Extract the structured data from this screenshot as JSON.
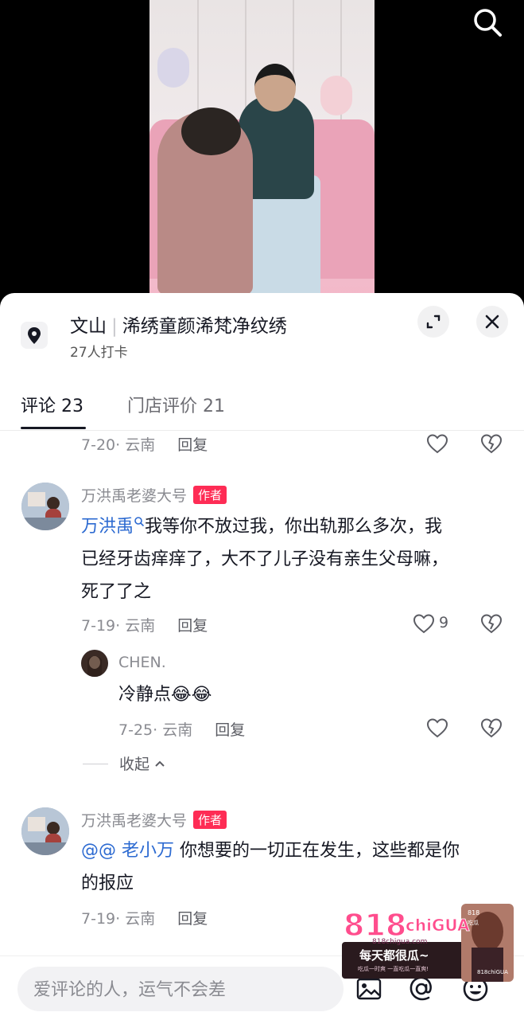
{
  "location": {
    "city": "文山",
    "shop": "浠绣童颜浠梵净纹绣",
    "checkins": "27人打卡"
  },
  "tabs": [
    {
      "label": "评论 23",
      "active": true
    },
    {
      "label": "门店评价 21",
      "active": false
    }
  ],
  "top_partial": {
    "meta": "7-20· 云南",
    "reply": "回复"
  },
  "comments": [
    {
      "username": "万洪禹老婆大号",
      "author_tag": "作者",
      "mention": "万洪禹",
      "text_line1": "我等你不放过我，你出轨那么多次，我",
      "text_line2": "已经牙齿痒痒了，大不了儿子没有亲生父母嘛，",
      "text_line3": "死了了之",
      "meta": "7-19· 云南",
      "reply": "回复",
      "likes": "9",
      "replies": [
        {
          "username": "CHEN.",
          "text": "冷静点",
          "emoji": "😂😂",
          "meta": "7-25· 云南",
          "reply": "回复"
        }
      ],
      "collapse_label": "收起"
    },
    {
      "username": "万洪禹老婆大号",
      "author_tag": "作者",
      "mention": "@@ 老小万",
      "text_line1": " 你想要的一切正在发生，这些都是你",
      "text_line2": "的报应",
      "meta": "7-19· 云南",
      "reply": "回复"
    }
  ],
  "input": {
    "placeholder": "爱评论的人，运气不会差"
  },
  "watermark": {
    "brand_num": "818",
    "brand_word": "chiGUA",
    "site": "818chigua.com",
    "slogan": "每天都很瓜~",
    "small": "吃瓜一时爽 一直吃瓜一直爽!",
    "corner_top": "818",
    "corner_mid": "吃瓜",
    "corner_bottom": "818chiGUA"
  },
  "colors": {
    "accent": "#fe2c55",
    "mention": "#2c6ad1",
    "text": "#161823",
    "muted": "#8a8b91"
  },
  "icons": [
    "search-icon",
    "location-pin-icon",
    "expand-icon",
    "close-icon",
    "heart-icon",
    "dislike-heart-icon",
    "chevron-up-icon",
    "image-icon",
    "at-icon",
    "emoji-icon"
  ]
}
